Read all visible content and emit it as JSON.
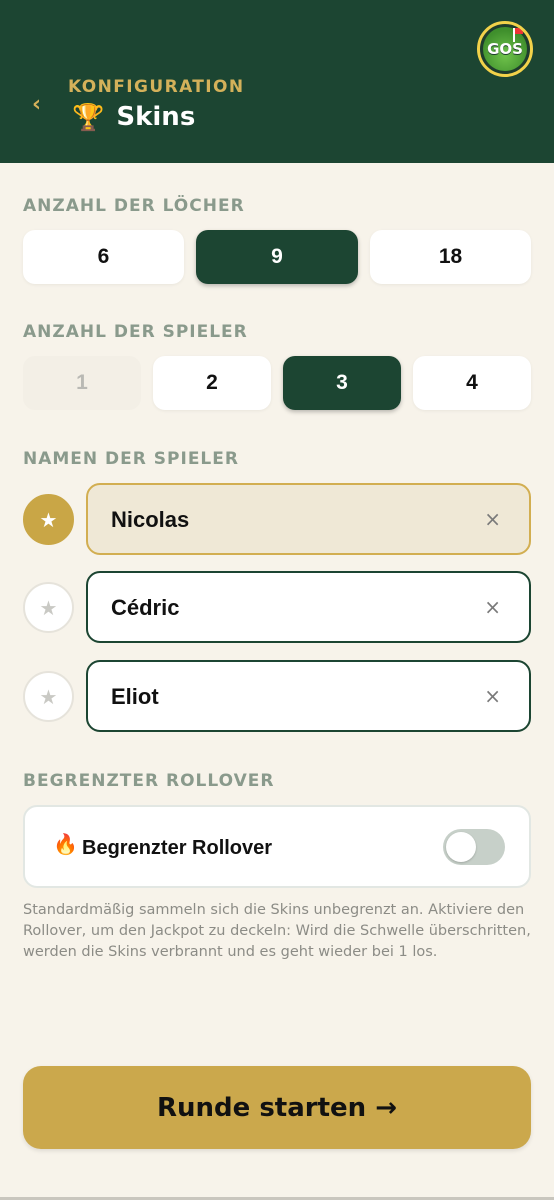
{
  "header": {
    "back_icon": "chevron-left-icon",
    "back_glyph": "‹",
    "kicker": "KONFIGURATION",
    "trophy_glyph": "🏆",
    "title": "Skins",
    "logo_text": "GOS",
    "background": "#1c4532",
    "accent": "#d4b15a"
  },
  "holes": {
    "label": "ANZAHL DER LÖCHER",
    "options": [
      "6",
      "9",
      "18"
    ],
    "selected": "9"
  },
  "players_count": {
    "label": "ANZAHL DER SPIELER",
    "options": [
      "1",
      "2",
      "3",
      "4"
    ],
    "selected": "3",
    "disabled": [
      "1"
    ]
  },
  "player_names": {
    "label": "NAMEN DER SPIELER",
    "star_glyph": "★",
    "clear_glyph": "×",
    "players": [
      {
        "name": "Nicolas",
        "starred": true
      },
      {
        "name": "Cédric",
        "starred": false
      },
      {
        "name": "Eliot",
        "starred": false
      }
    ]
  },
  "rollover": {
    "section_label": "BEGRENZTER ROLLOVER",
    "fire_glyph": "🔥",
    "toggle_label": "Begrenzter Rollover",
    "enabled": false,
    "help": "Standardmäßig sammeln sich die Skins unbegrenzt an. Aktiviere den Rollover, um den Jackpot zu deckeln: Wird die Schwelle überschritten, werden die Skins verbrannt und es geht wieder bei 1 los."
  },
  "start_button": {
    "label": "Runde starten →",
    "color": "#cba84c"
  }
}
